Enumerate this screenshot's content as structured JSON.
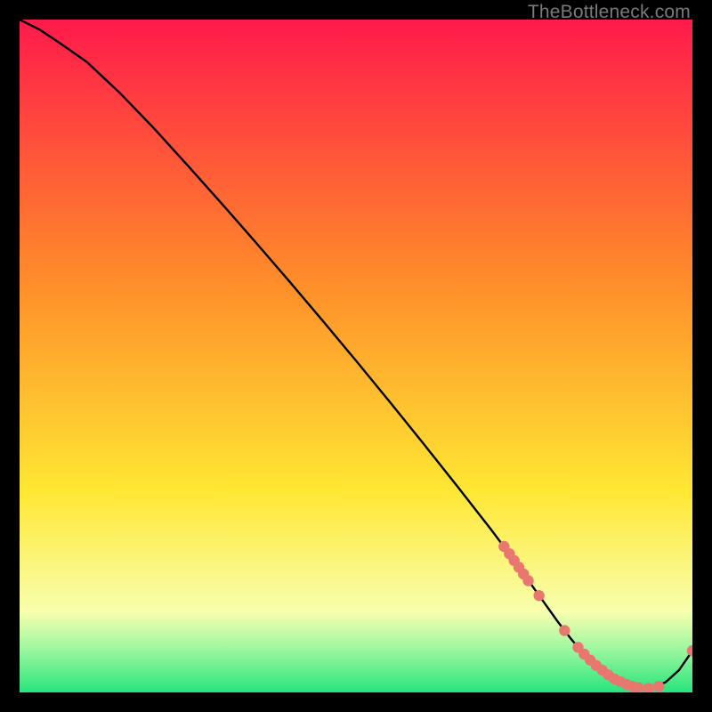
{
  "watermark": "TheBottleneck.com",
  "colors": {
    "bg": "#000000",
    "curve": "#000000",
    "marker_fill": "#e8776f",
    "marker_stroke": "#c45b52",
    "grad_top": "#ff1a4b",
    "grad_mid1": "#ff8a2a",
    "grad_mid2": "#ffe733",
    "grad_bottom_band": "#f8ffae",
    "grad_green1": "#9ef7a0",
    "grad_green2": "#27e57c"
  },
  "chart_data": {
    "type": "line",
    "title": "",
    "xlabel": "",
    "ylabel": "",
    "xlim": [
      0,
      100
    ],
    "ylim": [
      0,
      100
    ],
    "series": [
      {
        "name": "bottleneck-curve",
        "x": [
          0,
          3,
          6,
          10,
          15,
          20,
          25,
          30,
          35,
          40,
          45,
          50,
          55,
          60,
          65,
          70,
          73,
          75,
          78,
          80,
          82,
          84,
          86,
          88,
          90,
          92,
          94,
          96,
          98,
          100
        ],
        "y": [
          100,
          98.5,
          96.5,
          93.7,
          89,
          83.8,
          78.3,
          72.7,
          67,
          61.2,
          55.3,
          49.3,
          43.2,
          37,
          30.7,
          24.3,
          20.3,
          17.5,
          13.3,
          10.5,
          7.9,
          5.6,
          3.7,
          2.3,
          1.3,
          0.7,
          0.7,
          1.5,
          3.3,
          6.2
        ]
      }
    ],
    "markers": [
      {
        "x": 72.0,
        "y": 21.7
      },
      {
        "x": 72.8,
        "y": 20.6
      },
      {
        "x": 73.5,
        "y": 19.6
      },
      {
        "x": 74.2,
        "y": 18.6
      },
      {
        "x": 74.9,
        "y": 17.6
      },
      {
        "x": 75.6,
        "y": 16.6
      },
      {
        "x": 77.2,
        "y": 14.4
      },
      {
        "x": 81.0,
        "y": 9.2
      },
      {
        "x": 83.0,
        "y": 6.7
      },
      {
        "x": 83.9,
        "y": 5.7
      },
      {
        "x": 84.8,
        "y": 4.8
      },
      {
        "x": 85.7,
        "y": 4.0
      },
      {
        "x": 86.6,
        "y": 3.3
      },
      {
        "x": 87.5,
        "y": 2.6
      },
      {
        "x": 88.4,
        "y": 2.0
      },
      {
        "x": 89.3,
        "y": 1.6
      },
      {
        "x": 90.2,
        "y": 1.2
      },
      {
        "x": 91.1,
        "y": 0.9
      },
      {
        "x": 92.0,
        "y": 0.7
      },
      {
        "x": 93.5,
        "y": 0.6
      },
      {
        "x": 95.0,
        "y": 0.9
      },
      {
        "x": 100.0,
        "y": 6.2
      }
    ]
  }
}
